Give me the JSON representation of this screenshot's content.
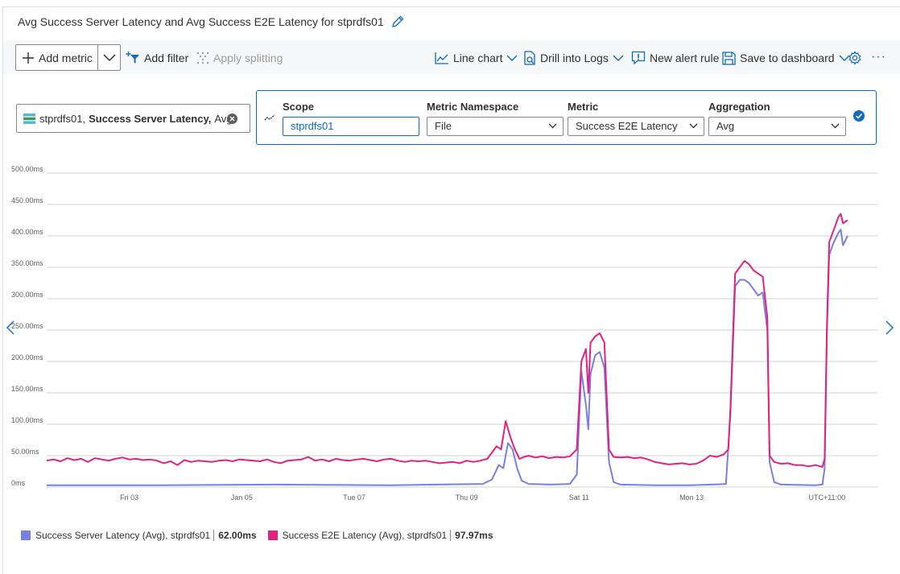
{
  "header": {
    "title": "Avg Success Server Latency and Avg Success E2E Latency for stprdfs01"
  },
  "toolbar": {
    "add_metric": "Add metric",
    "add_filter": "Add filter",
    "apply_splitting": "Apply splitting",
    "line_chart": "Line chart",
    "drill_logs": "Drill into Logs",
    "new_alert": "New alert rule",
    "save_dashboard": "Save to dashboard",
    "more": "···"
  },
  "metric_pill": {
    "resource": "stprdfs01,",
    "metric": "Success Server Latency,",
    "aggregation": "Avg"
  },
  "editor": {
    "scope_label": "Scope",
    "scope_value": "stprdfs01",
    "namespace_label": "Metric Namespace",
    "namespace_value": "File",
    "metric_label": "Metric",
    "metric_value": "Success E2E Latency",
    "aggregation_label": "Aggregation",
    "aggregation_value": "Avg"
  },
  "colors": {
    "accent": "#0f6cbd",
    "server_series": "#7a7fe8",
    "e2e_series": "#e0237f",
    "grid": "#d2d0ce"
  },
  "chart_data": {
    "type": "line",
    "ylim": [
      0,
      500
    ],
    "y_ticks": [
      "0ms",
      "50.00ms",
      "100.00ms",
      "150.00ms",
      "200.00ms",
      "250.00ms",
      "300.00ms",
      "350.00ms",
      "400.00ms",
      "450.00ms",
      "500.00ms"
    ],
    "x_range": [
      0,
      362
    ],
    "x_ticks": [
      {
        "label": "Fri 03",
        "x": 36
      },
      {
        "label": "Jan 05",
        "x": 85
      },
      {
        "label": "Tue 07",
        "x": 134
      },
      {
        "label": "Thu 09",
        "x": 183
      },
      {
        "label": "Sat 11",
        "x": 232
      },
      {
        "label": "Mon 13",
        "x": 281
      },
      {
        "label": "UTC+11:00",
        "x": 340
      }
    ],
    "series": [
      {
        "name": "Success Server Latency (Avg), stprdfs01",
        "summary": "62.00ms",
        "points": [
          [
            0,
            3
          ],
          [
            50,
            3
          ],
          [
            100,
            4
          ],
          [
            150,
            3
          ],
          [
            170,
            4
          ],
          [
            190,
            5
          ],
          [
            194,
            12
          ],
          [
            197,
            35
          ],
          [
            199,
            30
          ],
          [
            201,
            70
          ],
          [
            203,
            60
          ],
          [
            205,
            30
          ],
          [
            207,
            10
          ],
          [
            210,
            5
          ],
          [
            220,
            4
          ],
          [
            228,
            5
          ],
          [
            231,
            20
          ],
          [
            233,
            185
          ],
          [
            235,
            130
          ],
          [
            236,
            92
          ],
          [
            237,
            180
          ],
          [
            239,
            210
          ],
          [
            241,
            215
          ],
          [
            243,
            190
          ],
          [
            245,
            40
          ],
          [
            247,
            8
          ],
          [
            250,
            4
          ],
          [
            265,
            3
          ],
          [
            280,
            3
          ],
          [
            290,
            4
          ],
          [
            296,
            5
          ],
          [
            298,
            120
          ],
          [
            300,
            320
          ],
          [
            302,
            330
          ],
          [
            304,
            330
          ],
          [
            306,
            325
          ],
          [
            308,
            315
          ],
          [
            310,
            305
          ],
          [
            312,
            310
          ],
          [
            314,
            250
          ],
          [
            315,
            40
          ],
          [
            317,
            8
          ],
          [
            320,
            4
          ],
          [
            335,
            3
          ],
          [
            338,
            4
          ],
          [
            339,
            30
          ],
          [
            340,
            250
          ],
          [
            341,
            370
          ],
          [
            343,
            390
          ],
          [
            345,
            405
          ],
          [
            346,
            410
          ],
          [
            347,
            385
          ],
          [
            349,
            400
          ]
        ]
      },
      {
        "name": "Success E2E Latency (Avg), stprdfs01",
        "summary": "97.97ms",
        "points": [
          [
            0,
            42
          ],
          [
            3,
            44
          ],
          [
            6,
            41
          ],
          [
            9,
            46
          ],
          [
            12,
            43
          ],
          [
            15,
            45
          ],
          [
            18,
            40
          ],
          [
            21,
            46
          ],
          [
            24,
            44
          ],
          [
            27,
            42
          ],
          [
            30,
            45
          ],
          [
            33,
            47
          ],
          [
            36,
            44
          ],
          [
            39,
            45
          ],
          [
            42,
            43
          ],
          [
            45,
            44
          ],
          [
            48,
            42
          ],
          [
            51,
            38
          ],
          [
            54,
            41
          ],
          [
            57,
            35
          ],
          [
            60,
            43
          ],
          [
            63,
            40
          ],
          [
            66,
            42
          ],
          [
            69,
            41
          ],
          [
            72,
            40
          ],
          [
            75,
            42
          ],
          [
            78,
            43
          ],
          [
            81,
            41
          ],
          [
            84,
            44
          ],
          [
            87,
            43
          ],
          [
            90,
            42
          ],
          [
            93,
            41
          ],
          [
            96,
            44
          ],
          [
            99,
            40
          ],
          [
            102,
            38
          ],
          [
            105,
            42
          ],
          [
            108,
            43
          ],
          [
            111,
            44
          ],
          [
            114,
            48
          ],
          [
            117,
            42
          ],
          [
            120,
            44
          ],
          [
            123,
            41
          ],
          [
            126,
            45
          ],
          [
            129,
            43
          ],
          [
            132,
            42
          ],
          [
            135,
            44
          ],
          [
            138,
            45
          ],
          [
            141,
            43
          ],
          [
            144,
            41
          ],
          [
            147,
            44
          ],
          [
            150,
            45
          ],
          [
            153,
            42
          ],
          [
            156,
            40
          ],
          [
            159,
            42
          ],
          [
            162,
            41
          ],
          [
            165,
            42
          ],
          [
            168,
            40
          ],
          [
            171,
            38
          ],
          [
            174,
            39
          ],
          [
            177,
            40
          ],
          [
            180,
            38
          ],
          [
            183,
            42
          ],
          [
            186,
            40
          ],
          [
            189,
            42
          ],
          [
            192,
            45
          ],
          [
            194,
            55
          ],
          [
            196,
            65
          ],
          [
            198,
            60
          ],
          [
            200,
            105
          ],
          [
            202,
            80
          ],
          [
            204,
            60
          ],
          [
            206,
            45
          ],
          [
            208,
            48
          ],
          [
            210,
            50
          ],
          [
            213,
            47
          ],
          [
            216,
            49
          ],
          [
            219,
            46
          ],
          [
            222,
            48
          ],
          [
            225,
            47
          ],
          [
            228,
            49
          ],
          [
            231,
            60
          ],
          [
            233,
            200
          ],
          [
            235,
            220
          ],
          [
            236,
            150
          ],
          [
            237,
            230
          ],
          [
            239,
            240
          ],
          [
            241,
            245
          ],
          [
            243,
            230
          ],
          [
            245,
            60
          ],
          [
            247,
            48
          ],
          [
            250,
            47
          ],
          [
            253,
            48
          ],
          [
            256,
            46
          ],
          [
            259,
            47
          ],
          [
            262,
            44
          ],
          [
            265,
            40
          ],
          [
            268,
            38
          ],
          [
            271,
            36
          ],
          [
            274,
            37
          ],
          [
            277,
            38
          ],
          [
            280,
            36
          ],
          [
            283,
            37
          ],
          [
            286,
            42
          ],
          [
            289,
            50
          ],
          [
            292,
            48
          ],
          [
            295,
            52
          ],
          [
            297,
            60
          ],
          [
            298,
            130
          ],
          [
            300,
            340
          ],
          [
            302,
            350
          ],
          [
            304,
            360
          ],
          [
            306,
            355
          ],
          [
            308,
            345
          ],
          [
            310,
            340
          ],
          [
            312,
            335
          ],
          [
            314,
            270
          ],
          [
            315,
            50
          ],
          [
            317,
            40
          ],
          [
            320,
            37
          ],
          [
            323,
            38
          ],
          [
            326,
            35
          ],
          [
            329,
            35
          ],
          [
            332,
            33
          ],
          [
            335,
            35
          ],
          [
            338,
            32
          ],
          [
            339,
            45
          ],
          [
            340,
            260
          ],
          [
            341,
            390
          ],
          [
            343,
            410
          ],
          [
            345,
            430
          ],
          [
            346,
            435
          ],
          [
            347,
            420
          ],
          [
            349,
            425
          ]
        ]
      }
    ]
  }
}
